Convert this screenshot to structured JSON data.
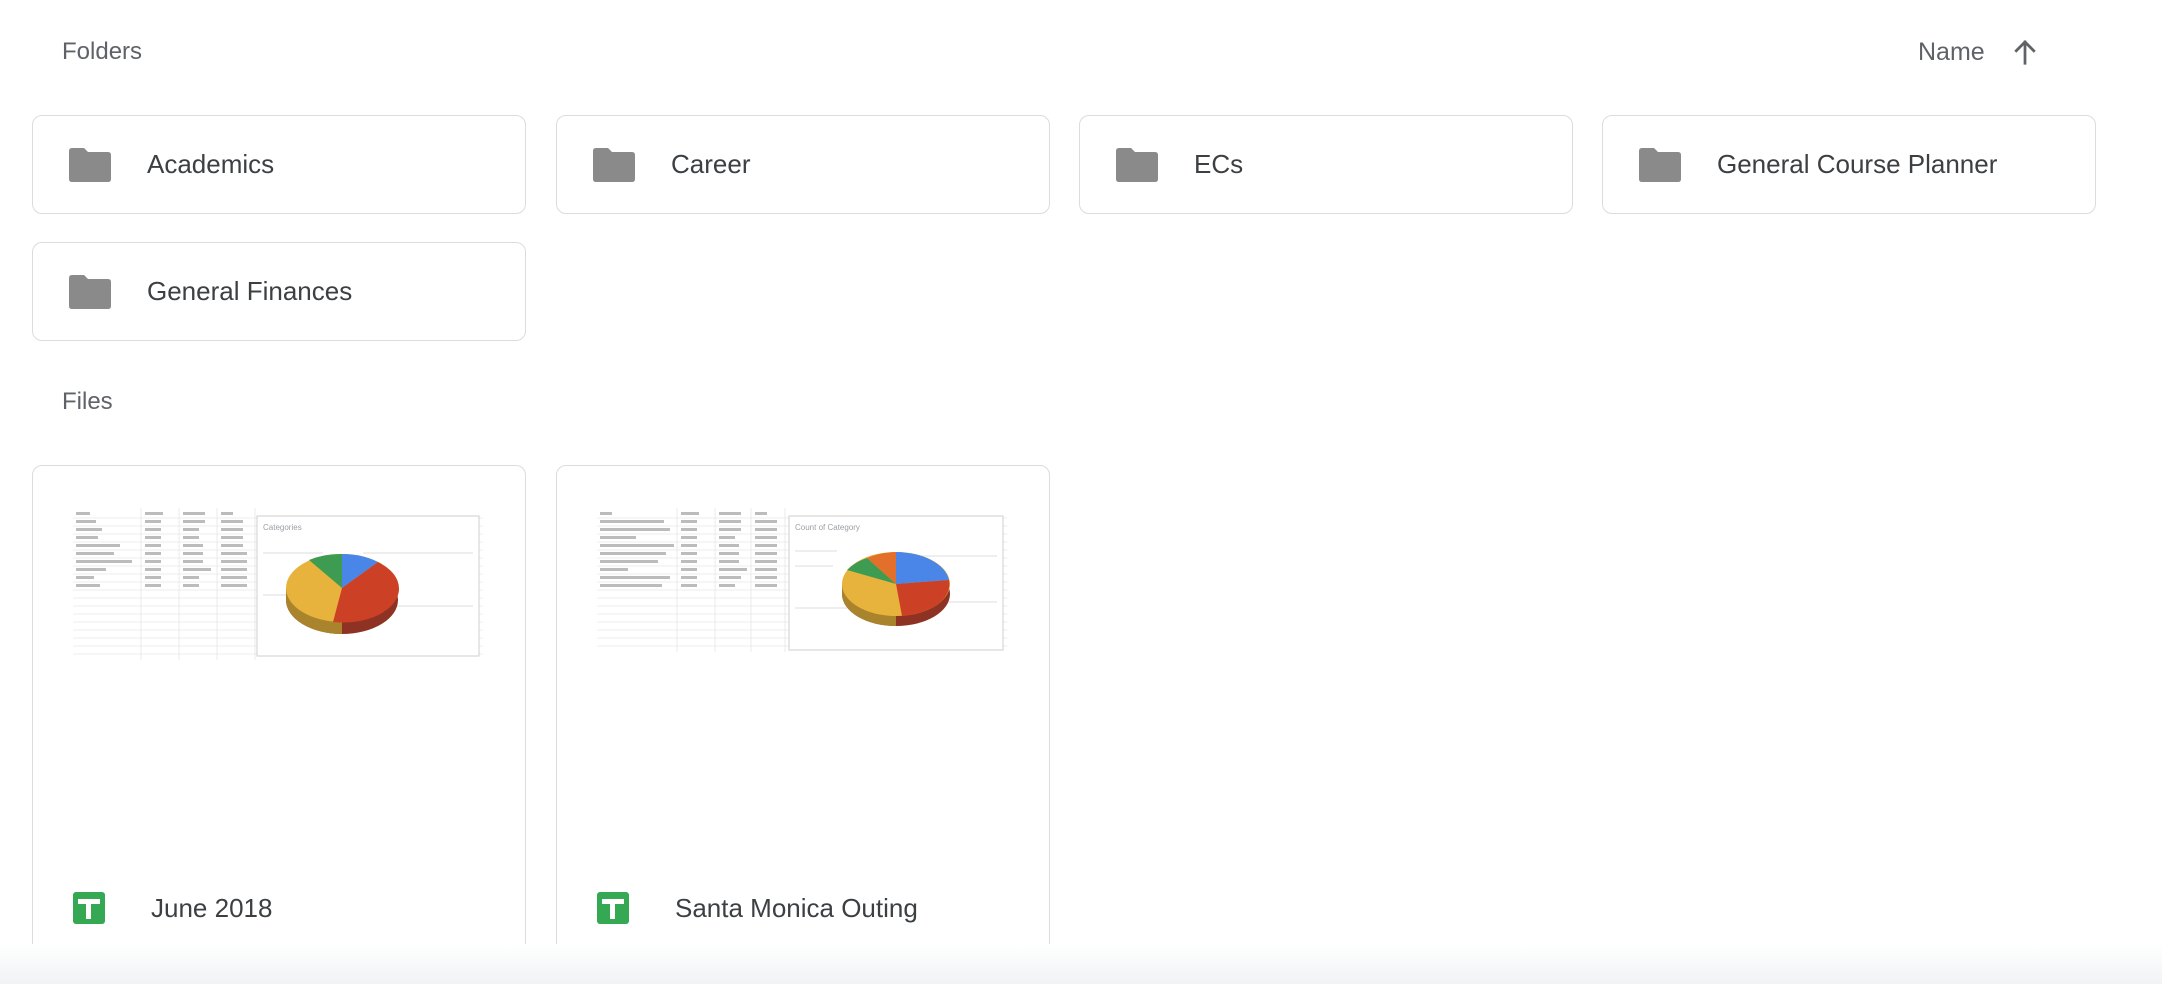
{
  "sections": {
    "folders_title": "Folders",
    "files_title": "Files"
  },
  "sort": {
    "label": "Name",
    "direction_icon": "arrow-up-icon"
  },
  "folders": [
    {
      "name": "Academics",
      "icon": "folder-icon"
    },
    {
      "name": "Career",
      "icon": "folder-icon"
    },
    {
      "name": "ECs",
      "icon": "folder-icon"
    },
    {
      "name": "General Course Planner",
      "icon": "folder-icon"
    },
    {
      "name": "General Finances",
      "icon": "folder-icon"
    }
  ],
  "files": [
    {
      "name": "June 2018",
      "icon": "google-sheets-icon",
      "thumbnail": {
        "chart_title": "Categories"
      }
    },
    {
      "name": "Santa Monica Outing",
      "icon": "google-sheets-icon",
      "thumbnail": {
        "chart_title": "Count of Category"
      }
    }
  ],
  "colors": {
    "folder_icon": "#8a8a8a",
    "sheets_green": "#34a853",
    "border": "#dadce0",
    "pie_blue": "#4a86e8",
    "pie_red": "#cc4125",
    "pie_yellow": "#e8b33c",
    "pie_green": "#3d9c51",
    "pie_orange": "#e2702a"
  }
}
